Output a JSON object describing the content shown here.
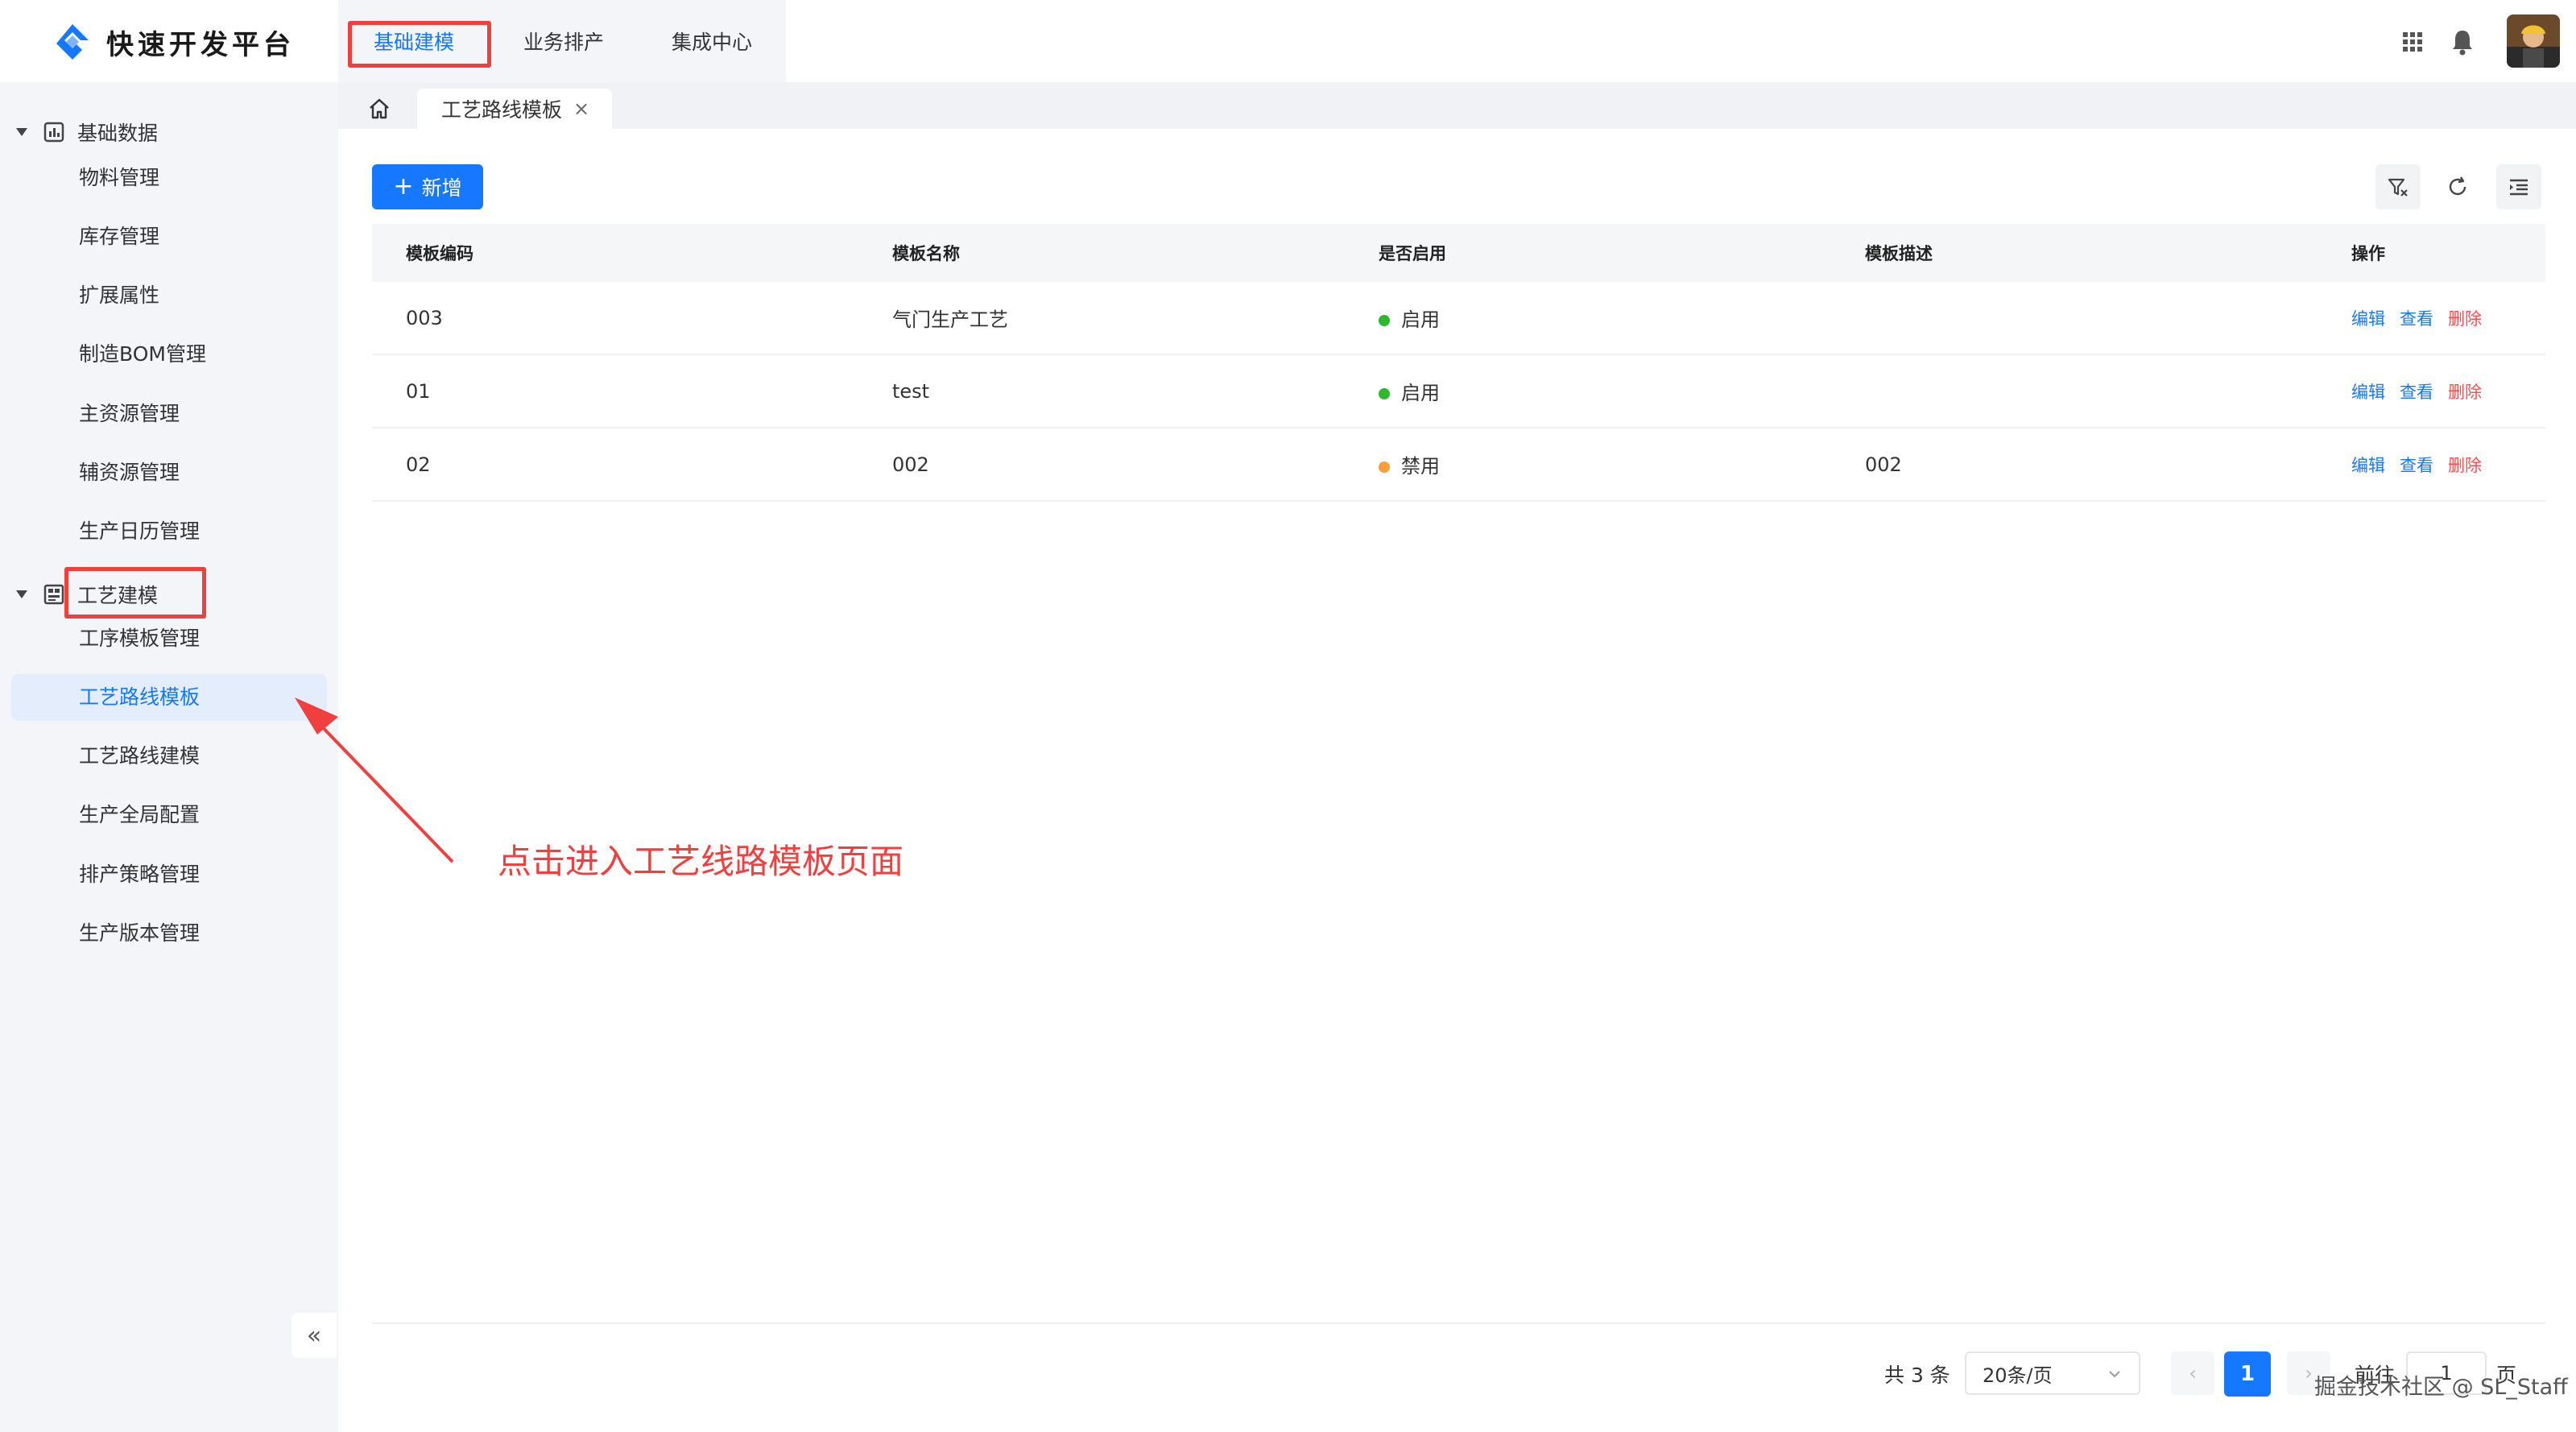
{
  "app": {
    "title": "快速开发平台",
    "top_tabs": [
      {
        "label": "基础建模",
        "active": true
      },
      {
        "label": "业务排产",
        "active": false
      },
      {
        "label": "集成中心",
        "active": false
      }
    ],
    "icons": [
      "apps-grid-icon",
      "bell-icon",
      "avatar"
    ]
  },
  "sidebar": {
    "groups": [
      {
        "label": "基础数据",
        "icon": "chart-icon",
        "items": [
          "物料管理",
          "库存管理",
          "扩展属性",
          "制造BOM管理",
          "主资源管理",
          "辅资源管理",
          "生产日历管理"
        ]
      },
      {
        "label": "工艺建模",
        "icon": "process-icon",
        "items": [
          "工序模板管理",
          "工艺路线模板",
          "工艺路线建模",
          "生产全局配置",
          "排产策略管理",
          "生产版本管理"
        ]
      }
    ],
    "active_item": "工艺路线模板",
    "collapse_label": "«"
  },
  "tabs": {
    "home_icon": "home-icon",
    "open_tab": "工艺路线模板",
    "close_label": "×"
  },
  "toolbar": {
    "add_label": "新增",
    "icons": [
      "filter-icon",
      "refresh-icon",
      "column-settings-icon"
    ]
  },
  "table": {
    "columns": [
      "模板编码",
      "模板名称",
      "是否启用",
      "模板描述",
      "操作"
    ],
    "rows": [
      {
        "code": "003",
        "name": "气门生产工艺",
        "status": "启用",
        "status_color": "#2eb82e",
        "desc": ""
      },
      {
        "code": "01",
        "name": "test",
        "status": "启用",
        "status_color": "#2eb82e",
        "desc": ""
      },
      {
        "code": "02",
        "name": "002",
        "status": "禁用",
        "status_color": "#fa9d3b",
        "desc": "002"
      }
    ],
    "actions": {
      "edit": "编辑",
      "view": "查看",
      "delete": "删除"
    }
  },
  "pagination": {
    "total_text": "共 3 条",
    "page_size": "20条/页",
    "current_page": "1",
    "goto_label": "前往",
    "goto_value": "1",
    "page_unit": "页"
  },
  "annotation": {
    "text": "点击进入工艺线路模板页面"
  },
  "watermark": "掘金技术社区 @ SL_Staff",
  "colors": {
    "primary": "#1677ff",
    "danger": "#ff4d4f",
    "annotation_red": "#ef3f3f",
    "sidebar_bg": "#f3f5f8",
    "active_bg": "#e3edfc"
  }
}
